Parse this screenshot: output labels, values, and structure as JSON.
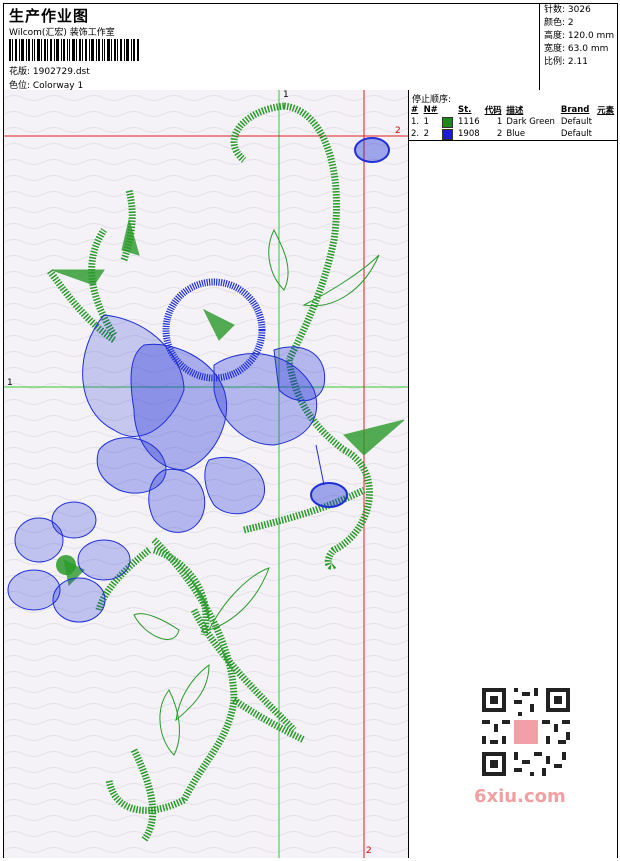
{
  "header": {
    "title": "生产作业图",
    "company": "Wilcom(汇宏) 装饰工作室",
    "design_label": "花版: 1902729.dst",
    "colorway_label": "色位: Colorway 1"
  },
  "stats": [
    {
      "label": "针数:",
      "value": "3026"
    },
    {
      "label": "颜色:",
      "value": "2"
    },
    {
      "label": "高度:",
      "value": "120.0 mm"
    },
    {
      "label": "宽度:",
      "value": "63.0 mm"
    },
    {
      "label": "比例:",
      "value": "2.11"
    }
  ],
  "stop_sequence": {
    "title": "停止顺序:",
    "columns": [
      "#",
      "N#",
      "St.",
      "代码",
      "描述",
      "Brand",
      "元素"
    ],
    "rows": [
      {
        "num": "1.",
        "n": "1",
        "st": "1116",
        "code": "1",
        "desc": "Dark Green",
        "brand": "Default",
        "color": "#1a8a1a"
      },
      {
        "num": "2.",
        "n": "2",
        "st": "1908",
        "code": "2",
        "desc": "Blue",
        "brand": "Default",
        "color": "#1a1ad8"
      }
    ]
  },
  "guides": {
    "green_label_top": "1",
    "green_label_left": "1",
    "red_label_right": "2",
    "red_label_bottom": "2"
  },
  "colors": {
    "green_thread": "#2a9a2a",
    "blue_thread": "#1f2fd6",
    "green_guide": "#33cc33",
    "red_guide": "#e02020",
    "canvas_bg": "#f4f2f6"
  },
  "watermark": {
    "text": "6xiu.com"
  }
}
